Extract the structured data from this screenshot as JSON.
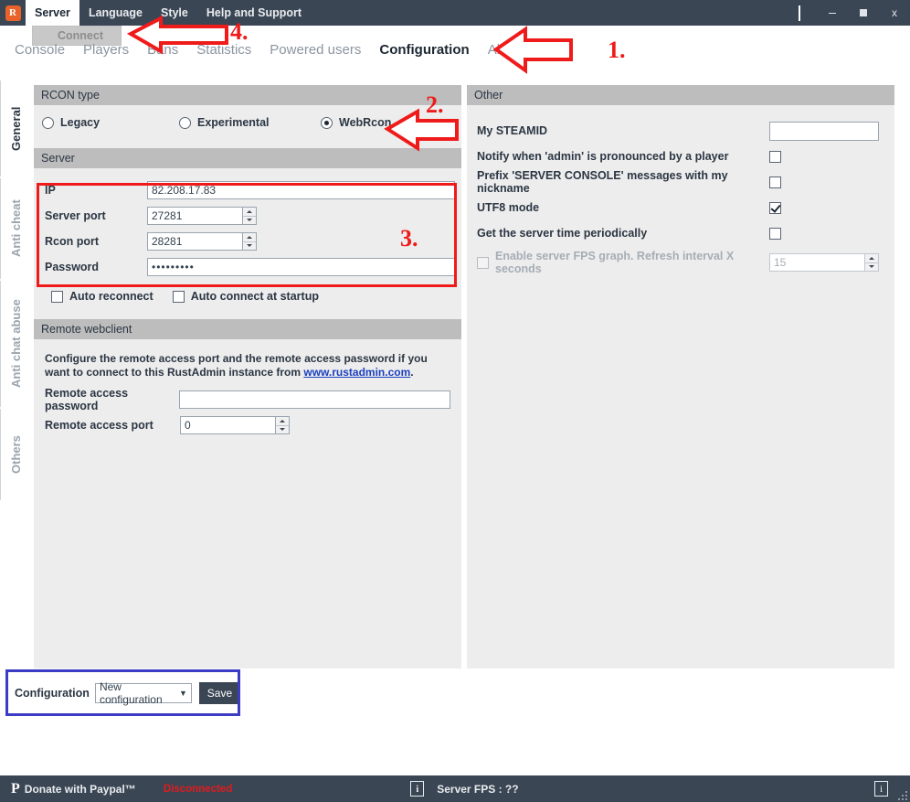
{
  "window": {
    "app_icon": "rust-gear-icon",
    "controls": {
      "minimize": "-",
      "maximize": "square",
      "close": "x"
    }
  },
  "menubar": {
    "items": [
      {
        "label": "Server",
        "open": true
      },
      {
        "label": "Language",
        "open": false
      },
      {
        "label": "Style",
        "open": false
      },
      {
        "label": "Help and Support",
        "open": false
      }
    ],
    "open_menu_items": [
      {
        "label": "Connect",
        "disabled": true
      }
    ]
  },
  "main_tabs": [
    {
      "label": "Console",
      "active": false
    },
    {
      "label": "Players",
      "active": false
    },
    {
      "label": "Bans",
      "active": false
    },
    {
      "label": "Statistics",
      "active": false
    },
    {
      "label": "Powered users",
      "active": false
    },
    {
      "label": "Configuration",
      "active": true
    },
    {
      "label": "About",
      "active": false
    }
  ],
  "side_tabs": [
    {
      "label": "General",
      "active": true
    },
    {
      "label": "Anti cheat",
      "active": false
    },
    {
      "label": "Anti chat abuse",
      "active": false
    },
    {
      "label": "Others",
      "active": false
    }
  ],
  "left_panel": {
    "rcon_type": {
      "header": "RCON type",
      "options": [
        {
          "label": "Legacy",
          "selected": false
        },
        {
          "label": "Experimental",
          "selected": false
        },
        {
          "label": "WebRcon",
          "selected": true
        }
      ]
    },
    "server": {
      "header": "Server",
      "fields": [
        {
          "label": "IP",
          "value": "82.208.17.83",
          "spinner": false
        },
        {
          "label": "Server port",
          "value": "27281",
          "spinner": true
        },
        {
          "label": "Rcon port",
          "value": "28281",
          "spinner": true
        },
        {
          "label": "Password",
          "value": "•••••••••",
          "spinner": false
        }
      ],
      "checkboxes": [
        {
          "label": "Auto reconnect",
          "checked": false
        },
        {
          "label": "Auto connect at startup",
          "checked": false
        }
      ]
    },
    "remote_webclient": {
      "header": "Remote webclient",
      "description_part1": "Configure the remote access port and the remote access password if you want to connect to this RustAdmin instance from ",
      "description_link": "www.rustadmin.com",
      "description_part2": ".",
      "password_label": "Remote access password",
      "password_value": "",
      "port_label": "Remote access port",
      "port_value": "0"
    }
  },
  "right_panel": {
    "header": "Other",
    "steamid_label": "My STEAMID",
    "steamid_value": "",
    "checkboxes": [
      {
        "label": "Notify when 'admin' is pronounced by a player",
        "checked": false,
        "disabled": false
      },
      {
        "label": "Prefix 'SERVER CONSOLE' messages with my nickname",
        "checked": false,
        "disabled": false
      },
      {
        "label": "UTF8 mode",
        "checked": true,
        "disabled": false
      },
      {
        "label": "Get the server time periodically",
        "checked": false,
        "disabled": false
      }
    ],
    "fps_graph": {
      "label": "Enable server FPS graph. Refresh interval X seconds",
      "checked": false,
      "disabled": true,
      "value": "15"
    }
  },
  "config_bar": {
    "label": "Configuration",
    "select_value": "New configuration",
    "save_label": "Save"
  },
  "status_bar": {
    "donate_label": "Donate with Paypal™",
    "donate_icon": "paypal-icon",
    "connection_status": "Disconnected",
    "info_icon": "info-icon",
    "server_fps": "Server FPS : ??",
    "right_info_icon": "info-icon"
  },
  "annotations": [
    {
      "number": "1."
    },
    {
      "number": "2."
    },
    {
      "number": "3."
    },
    {
      "number": "4."
    }
  ],
  "colors": {
    "titlebar": "#3b4654",
    "accent_red": "#ef1b1b",
    "accent_blue": "#3b3bc4",
    "panel": "#ededed",
    "group_header": "#bdbdbd",
    "disconnected": "#e01b1b",
    "link": "#1b3fbf"
  }
}
